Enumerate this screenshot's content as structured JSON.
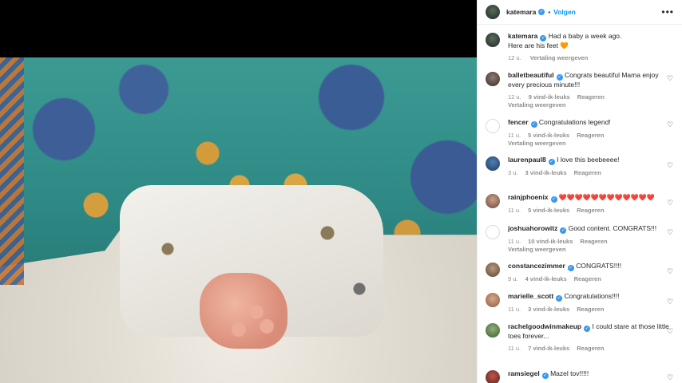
{
  "post": {
    "author": "katemara",
    "follow_label": "Volgen",
    "caption": "Had a baby a week ago.\nHere are his feet 🧡",
    "time": "12 u.",
    "translate_label": "Vertaling weergeven"
  },
  "icons": {
    "more": "more-options-icon",
    "like": "heart-icon",
    "verified": "verified-badge-icon"
  },
  "colors": {
    "accent": "#0095f6",
    "verified": "#3897f0",
    "meta": "#8e8e8e"
  },
  "comments": [
    {
      "user": "balletbeautiful",
      "text": "Congrats beautiful Mama enjoy every precious minute!!!",
      "time": "12 u.",
      "likes": "9 vind-ik-leuks",
      "reply": "Reageren",
      "translate": "Vertaling weergeven"
    },
    {
      "user": "fencer",
      "text": "Congratulations legend!",
      "time": "11 u.",
      "likes": "5 vind-ik-leuks",
      "reply": "Reageren",
      "translate": "Vertaling weergeven"
    },
    {
      "user": "laurenpaul8",
      "text": "I love this beebeeee!",
      "time": "3 u.",
      "likes": "3 vind-ik-leuks",
      "reply": "Reageren",
      "translate": ""
    },
    {
      "user": "rainjphoenix",
      "text": "❤️❤️❤️❤️❤️❤️❤️❤️❤️❤️❤️❤️",
      "time": "11 u.",
      "likes": "5 vind-ik-leuks",
      "reply": "Reageren",
      "translate": ""
    },
    {
      "user": "joshuahorowitz",
      "text": "Good content. CONGRATS!!!",
      "time": "11 u.",
      "likes": "10 vind-ik-leuks",
      "reply": "Reageren",
      "translate": "Vertaling weergeven"
    },
    {
      "user": "constancezimmer",
      "text": "CONGRATS!!!!",
      "time": "9 u.",
      "likes": "4 vind-ik-leuks",
      "reply": "Reageren",
      "translate": ""
    },
    {
      "user": "marielle_scott",
      "text": "Congratulations!!!!",
      "time": "11 u.",
      "likes": "3 vind-ik-leuks",
      "reply": "Reageren",
      "translate": ""
    },
    {
      "user": "rachelgoodwinmakeup",
      "text": "I could stare at those little toes forever...",
      "time": "11 u.",
      "likes": "7 vind-ik-leuks",
      "reply": "Reageren",
      "translate": ""
    },
    {
      "user": "ramsiegel",
      "text": "Mazel tov!!!!!",
      "time": "",
      "likes": "",
      "reply": "",
      "translate": ""
    }
  ]
}
